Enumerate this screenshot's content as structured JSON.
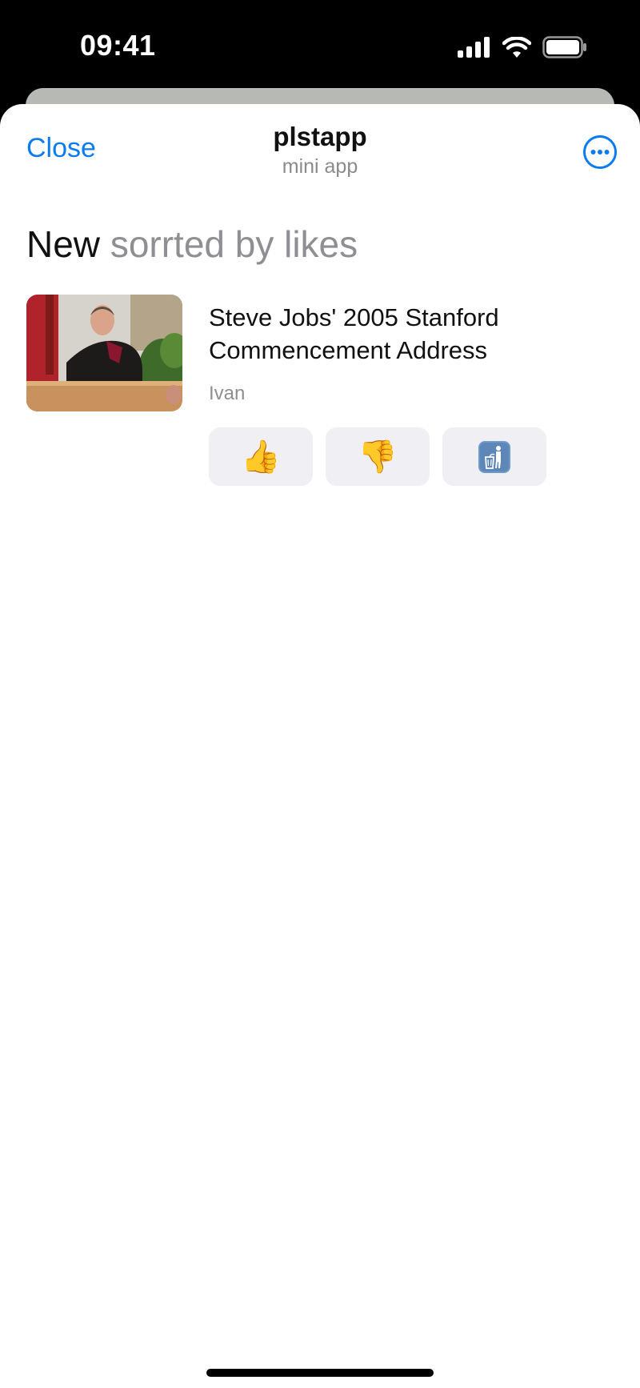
{
  "status_bar": {
    "time": "09:41"
  },
  "nav": {
    "close_label": "Close",
    "title": "plstapp",
    "subtitle": "mini app",
    "more_icon": "ellipsis-circle-icon"
  },
  "section": {
    "heading": "New",
    "subheading": "sorrted by likes"
  },
  "item": {
    "title": "Steve Jobs' 2005 Stanford Commencement Address",
    "author": "Ivan",
    "like_emoji": "👍",
    "dislike_emoji": "👎",
    "delete_icon": "🚮"
  },
  "colors": {
    "accent": "#0a7cf0",
    "secondary_text": "#8e8e93",
    "button_bg": "#efeff4"
  }
}
